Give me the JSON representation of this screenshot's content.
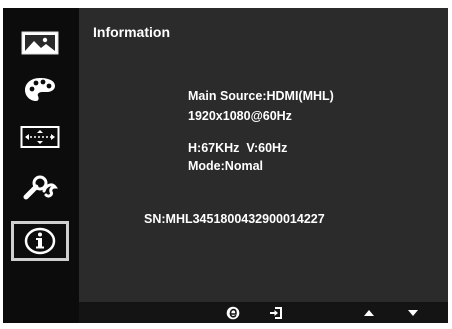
{
  "sidebar": {
    "items": [
      {
        "name": "picture-icon"
      },
      {
        "name": "palette-icon"
      },
      {
        "name": "display-position-icon"
      },
      {
        "name": "settings-wrench-icon"
      },
      {
        "name": "information-icon",
        "selected": true
      }
    ]
  },
  "content": {
    "title": "Information",
    "main_source": "Main Source:HDMI(MHL)",
    "resolution": "1920x1080@60Hz",
    "frequency": "H:67KHz  V:60Hz",
    "mode": "Mode:Nomal",
    "serial": "SN:MHL3451800432900014227"
  },
  "buttons": {
    "items": [
      "e-key-icon",
      "input-source-icon",
      "up-arrow-icon",
      "down-arrow-icon"
    ]
  },
  "colors": {
    "background": "#141414",
    "content_bg": "#2b2b2b",
    "text": "#ffffff",
    "selected_border": "#cfcfcf"
  }
}
